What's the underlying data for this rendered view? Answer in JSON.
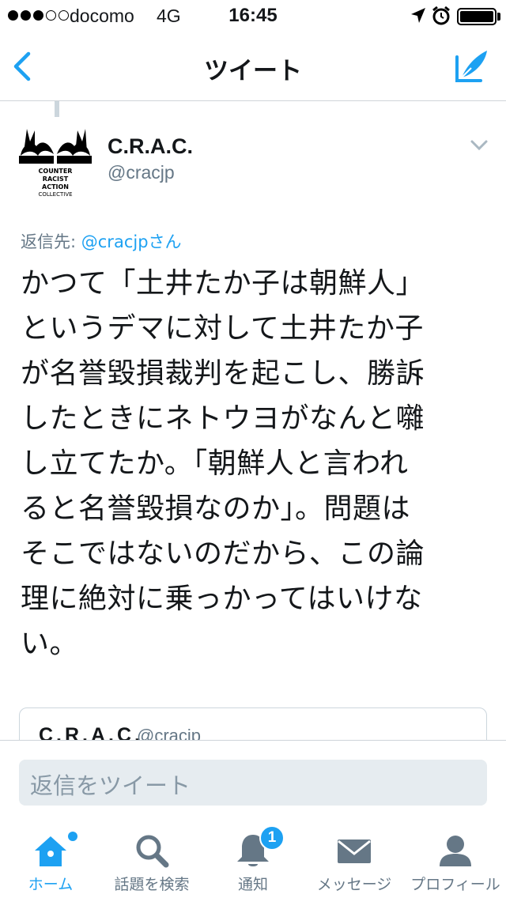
{
  "status_bar": {
    "carrier": "docomo",
    "network": "4G",
    "time": "16:45",
    "signal_bars_filled": 3,
    "signal_bars_total": 5,
    "battery_level": 1.0,
    "icons": [
      "location-icon",
      "alarm-icon",
      "battery-icon"
    ]
  },
  "nav": {
    "title": "ツイート",
    "back_icon": "chevron-left-icon",
    "compose_icon": "compose-tweet-icon"
  },
  "tweet": {
    "user_name": "C.R.A.C.",
    "user_handle": "@cracjp",
    "reply_prefix": "返信先: ",
    "reply_mention": "@cracjpさん",
    "text_lines": [
      "かつて「土井たか子は朝鮮人」",
      "というデマに対して土井たか子",
      "が名誉毀損裁判を起こし、勝訴",
      "したときにネトウヨがなんと囃",
      "し立てたか。「朝鮮人と言われ",
      "ると名誉毀損なのか」。問題は",
      "そこではないのだから、この論",
      "理に絶対に乗っかってはいけな",
      "い。"
    ],
    "avatar_text": [
      "COUNTER",
      "RACIST",
      "ACTION",
      "COLLECTIVE"
    ]
  },
  "quoted_tweet": {
    "name": "C.R.A.C.",
    "handle": "@cracjp"
  },
  "reply_bar": {
    "placeholder": "返信をツイート"
  },
  "tab_bar": {
    "tabs": [
      {
        "label": "ホーム",
        "icon": "home-icon",
        "active": true
      },
      {
        "label": "話題を検索",
        "icon": "search-icon",
        "active": false
      },
      {
        "label": "通知",
        "icon": "bell-icon",
        "active": false,
        "badge": "1"
      },
      {
        "label": "メッセージ",
        "icon": "envelope-icon",
        "active": false
      },
      {
        "label": "プロフィール",
        "icon": "person-icon",
        "active": false
      }
    ]
  },
  "colors": {
    "accent": "#1da1f2",
    "text": "#14171a",
    "secondary": "#657786",
    "input_bg": "#e6ecf0"
  }
}
